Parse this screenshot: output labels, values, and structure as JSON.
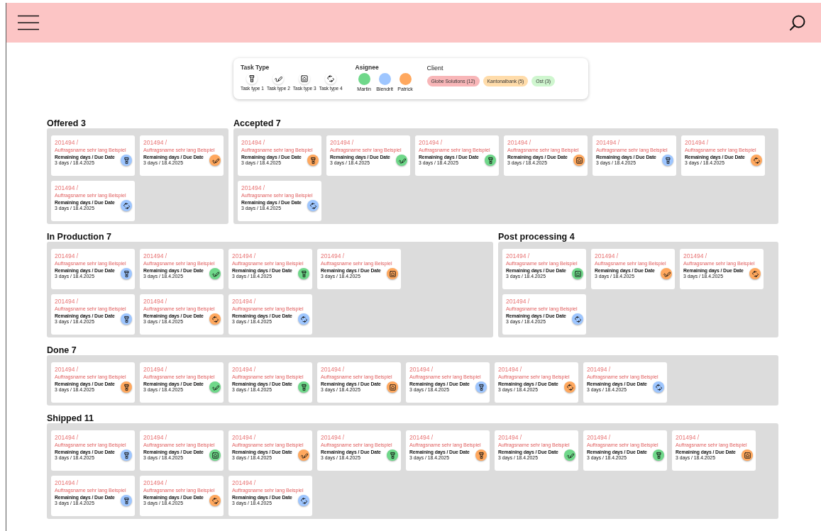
{
  "legend": {
    "task_type_title": "Task Type",
    "task_types": [
      {
        "label": "Task type 1",
        "kind": "flashlight"
      },
      {
        "label": "Task type 2",
        "kind": "pencil"
      },
      {
        "label": "Task type 3",
        "kind": "tray"
      },
      {
        "label": "Task type 4",
        "kind": "rotate"
      }
    ],
    "assignee_title": "Asignee",
    "assignees": [
      {
        "name": "Martin",
        "color": "#6fd88a"
      },
      {
        "name": "Blendrit",
        "color": "#9ec6ff"
      },
      {
        "name": "Patrick",
        "color": "#ffa85e"
      }
    ],
    "client_title": "Client",
    "clients": [
      {
        "label": "Globe Solutions (12)",
        "color": "#f8b6b8"
      },
      {
        "label": "Kantonalbank (5)",
        "color": "#ffdcaa"
      },
      {
        "label": "Ost (3)",
        "color": "#cff6cf"
      }
    ]
  },
  "board_rows": [
    [
      {
        "title": "Offered 3",
        "cards": [
          {
            "number": "201494 /",
            "name": "Auftragsname sehr lang Beispiel",
            "label": "Remaining days / Due Date",
            "due": "3 days / 18.4.2025",
            "kind": "flashlight",
            "color": "#9ec6ff"
          },
          {
            "number": "201494 /",
            "name": "Auftragsname sehr lang Beispiel",
            "label": "Remaining days / Due Date",
            "due": "3 days / 18.4.2025",
            "kind": "pencil",
            "color": "#ffa85e"
          },
          {
            "number": "201494 /",
            "name": "Auftragsname sehr lang Beispiel",
            "label": "Remaining days / Due Date",
            "due": "3 days / 18.4.2025",
            "kind": "rotate",
            "color": "#9ec6ff"
          }
        ]
      },
      {
        "title": "Accepted 7",
        "cards": [
          {
            "number": "201494 /",
            "name": "Auftragsname sehr lang Beispiel",
            "label": "Remaining days / Due Date",
            "due": "3 days / 18.4.2025",
            "kind": "flashlight",
            "color": "#ffa85e"
          },
          {
            "number": "201494 /",
            "name": "Auftragsname sehr lang Beispiel",
            "label": "Remaining days / Due Date",
            "due": "3 days / 18.4.2025",
            "kind": "pencil",
            "color": "#6fd88a"
          },
          {
            "number": "201494 /",
            "name": "Auftragsname sehr lang Beispiel",
            "label": "Remaining days / Due Date",
            "due": "3 days / 18.4.2025",
            "kind": "flashlight",
            "color": "#6fd88a"
          },
          {
            "number": "201494 /",
            "name": "Auftragsname sehr lang Beispiel",
            "label": "Remaining days / Due Date",
            "due": "3 days / 18.4.2025",
            "kind": "tray",
            "color": "#ffa85e"
          },
          {
            "number": "201494 /",
            "name": "Auftragsname sehr lang Beispiel",
            "label": "Remaining days / Due Date",
            "due": "3 days / 18.4.2025",
            "kind": "flashlight",
            "color": "#9ec6ff"
          },
          {
            "number": "201494 /",
            "name": "Auftragsname sehr lang Beispiel",
            "label": "Remaining days / Due Date",
            "due": "3 days / 18.4.2025",
            "kind": "rotate",
            "color": "#ffa85e"
          },
          {
            "number": "201494 /",
            "name": "Auftragsname sehr lang Beispiel",
            "label": "Remaining days / Due Date",
            "due": "3 days / 18.4.2025",
            "kind": "rotate",
            "color": "#9ec6ff"
          }
        ]
      }
    ],
    [
      {
        "title": "In Production 7",
        "cards": [
          {
            "number": "201494 /",
            "name": "Auftragsname sehr lang Beispiel",
            "label": "Remaining days / Due Date",
            "due": "3 days / 18.4.2025",
            "kind": "flashlight",
            "color": "#9ec6ff"
          },
          {
            "number": "201494 /",
            "name": "Auftragsname sehr lang Beispiel",
            "label": "Remaining days / Due Date",
            "due": "3 days / 18.4.2025",
            "kind": "pencil",
            "color": "#6fd88a"
          },
          {
            "number": "201494 /",
            "name": "Auftragsname sehr lang Beispiel",
            "label": "Remaining days / Due Date",
            "due": "3 days / 18.4.2025",
            "kind": "flashlight",
            "color": "#6fd88a"
          },
          {
            "number": "201494 /",
            "name": "Auftragsname sehr lang Beispiel",
            "label": "Remaining days / Due Date",
            "due": "3 days / 18.4.2025",
            "kind": "tray",
            "color": "#ffa85e"
          },
          {
            "number": "201494 /",
            "name": "Auftragsname sehr lang Beispiel",
            "label": "Remaining days / Due Date",
            "due": "3 days / 18.4.2025",
            "kind": "flashlight",
            "color": "#9ec6ff"
          },
          {
            "number": "201494 /",
            "name": "Auftragsname sehr lang Beispiel",
            "label": "Remaining days / Due Date",
            "due": "3 days / 18.4.2025",
            "kind": "rotate",
            "color": "#ffa85e"
          },
          {
            "number": "201494 /",
            "name": "Auftragsname sehr lang Beispiel",
            "label": "Remaining days / Due Date",
            "due": "3 days / 18.4.2025",
            "kind": "rotate",
            "color": "#9ec6ff"
          }
        ]
      },
      {
        "title": "Post processing 4",
        "cards": [
          {
            "number": "201494 /",
            "name": "Auftragsname sehr lang Beispiel",
            "label": "Remaining days / Due Date",
            "due": "3 days / 18.4.2025",
            "kind": "tray",
            "color": "#6fd88a"
          },
          {
            "number": "201494 /",
            "name": "Auftragsname sehr lang Beispiel",
            "label": "Remaining days / Due Date",
            "due": "3 days / 18.4.2025",
            "kind": "pencil",
            "color": "#ffa85e"
          },
          {
            "number": "201494 /",
            "name": "Auftragsname sehr lang Beispiel",
            "label": "Remaining days / Due Date",
            "due": "3 days / 18.4.2025",
            "kind": "rotate",
            "color": "#ffa85e"
          },
          {
            "number": "201494 /",
            "name": "Auftragsname sehr lang Beispiel",
            "label": "Remaining days / Due Date",
            "due": "3 days / 18.4.2025",
            "kind": "rotate",
            "color": "#9ec6ff"
          }
        ]
      }
    ],
    [
      {
        "title": "Done 7",
        "cards": [
          {
            "number": "201494 /",
            "name": "Auftragsname sehr lang Beispiel",
            "label": "Remaining days / Due Date",
            "due": "3 days / 18.4.2025",
            "kind": "flashlight",
            "color": "#ffa85e"
          },
          {
            "number": "201494 /",
            "name": "Auftragsname sehr lang Beispiel",
            "label": "Remaining days / Due Date",
            "due": "3 days / 18.4.2025",
            "kind": "pencil",
            "color": "#6fd88a"
          },
          {
            "number": "201494 /",
            "name": "Auftragsname sehr lang Beispiel",
            "label": "Remaining days / Due Date",
            "due": "3 days / 18.4.2025",
            "kind": "flashlight",
            "color": "#6fd88a"
          },
          {
            "number": "201494 /",
            "name": "Auftragsname sehr lang Beispiel",
            "label": "Remaining days / Due Date",
            "due": "3 days / 18.4.2025",
            "kind": "tray",
            "color": "#ffa85e"
          },
          {
            "number": "201494 /",
            "name": "Auftragsname sehr lang Beispiel",
            "label": "Remaining days / Due Date",
            "due": "3 days / 18.4.2025",
            "kind": "flashlight",
            "color": "#9ec6ff"
          },
          {
            "number": "201494 /",
            "name": "Auftragsname sehr lang Beispiel",
            "label": "Remaining days / Due Date",
            "due": "3 days / 18.4.2025",
            "kind": "rotate",
            "color": "#ffa85e"
          },
          {
            "number": "201494 /",
            "name": "Auftragsname sehr lang Beispiel",
            "label": "Remaining days / Due Date",
            "due": "3 days / 18.4.2025",
            "kind": "rotate",
            "color": "#9ec6ff"
          }
        ]
      }
    ],
    [
      {
        "title": "Shipped 11",
        "cards": [
          {
            "number": "201494 /",
            "name": "Auftragsname sehr lang Beispiel",
            "label": "Remaining days / Due Date",
            "due": "3 days / 18.4.2025",
            "kind": "flashlight",
            "color": "#9ec6ff"
          },
          {
            "number": "201494 /",
            "name": "Auftragsname sehr lang Beispiel",
            "label": "Remaining days / Due Date",
            "due": "3 days / 18.4.2025",
            "kind": "tray",
            "color": "#6fd88a"
          },
          {
            "number": "201494 /",
            "name": "Auftragsname sehr lang Beispiel",
            "label": "Remaining days / Due Date",
            "due": "3 days / 18.4.2025",
            "kind": "pencil",
            "color": "#ffa85e"
          },
          {
            "number": "201494 /",
            "name": "Auftragsname sehr lang Beispiel",
            "label": "Remaining days / Due Date",
            "due": "3 days / 18.4.2025",
            "kind": "flashlight",
            "color": "#6fd88a"
          },
          {
            "number": "201494 /",
            "name": "Auftragsname sehr lang Beispiel",
            "label": "Remaining days / Due Date",
            "due": "3 days / 18.4.2025",
            "kind": "flashlight",
            "color": "#ffa85e"
          },
          {
            "number": "201494 /",
            "name": "Auftragsname sehr lang Beispiel",
            "label": "Remaining days / Due Date",
            "due": "3 days / 18.4.2025",
            "kind": "pencil",
            "color": "#6fd88a"
          },
          {
            "number": "201494 /",
            "name": "Auftragsname sehr lang Beispiel",
            "label": "Remaining days / Due Date",
            "due": "3 days / 18.4.2025",
            "kind": "flashlight",
            "color": "#6fd88a"
          },
          {
            "number": "201494 /",
            "name": "Auftragsname sehr lang Beispiel",
            "label": "Remaining days / Due Date",
            "due": "3 days / 18.4.2025",
            "kind": "tray",
            "color": "#ffa85e"
          },
          {
            "number": "201494 /",
            "name": "Auftragsname sehr lang Beispiel",
            "label": "Remaining days / Due Date",
            "due": "3 days / 18.4.2025",
            "kind": "flashlight",
            "color": "#9ec6ff"
          },
          {
            "number": "201494 /",
            "name": "Auftragsname sehr lang Beispiel",
            "label": "Remaining days / Due Date",
            "due": "3 days / 18.4.2025",
            "kind": "rotate",
            "color": "#ffa85e"
          },
          {
            "number": "201494 /",
            "name": "Auftragsname sehr lang Beispiel",
            "label": "Remaining days / Due Date",
            "due": "3 days / 18.4.2025",
            "kind": "rotate",
            "color": "#9ec6ff"
          }
        ]
      }
    ]
  ]
}
